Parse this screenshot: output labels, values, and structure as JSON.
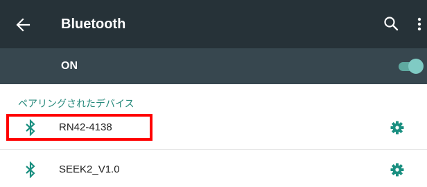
{
  "toolbar": {
    "title": "Bluetooth",
    "back_icon": "arrow-left-icon",
    "search_icon": "search-icon",
    "more_icon": "more-vert-icon",
    "background": "#263238"
  },
  "switch_bar": {
    "label": "ON",
    "state": "on",
    "background": "#37474f",
    "accent": "#80cbc4"
  },
  "paired_section": {
    "header": "ペアリングされたデバイス",
    "header_color": "#26897b",
    "devices": [
      {
        "name": "RN42-4138",
        "icon": "bluetooth-icon",
        "settings_icon": "gear-icon"
      },
      {
        "name": "SEEK2_V1.0",
        "icon": "bluetooth-icon",
        "settings_icon": "gear-icon"
      }
    ]
  },
  "annotation": {
    "highlight_color": "#ff0000"
  }
}
